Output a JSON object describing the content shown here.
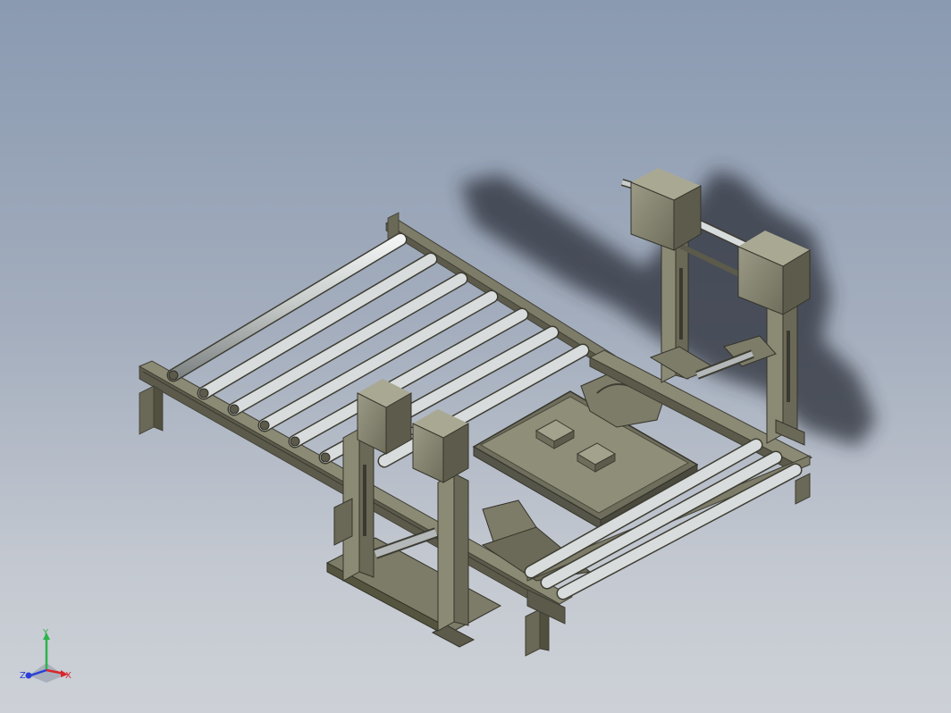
{
  "viewport": {
    "model_description": "conveyor-transfer-station"
  },
  "triad": {
    "x_label": "X",
    "y_label": "Y",
    "z_label": "Z",
    "x_color": "#d8262a",
    "y_color": "#2db34a",
    "z_color": "#2a3fd6"
  },
  "colors": {
    "frame": "#7d7c68",
    "frame_dark": "#4d4c3f",
    "roller": "#c9cdcc",
    "roller_shade": "#8e9393",
    "shadow": "#2b2f38"
  }
}
